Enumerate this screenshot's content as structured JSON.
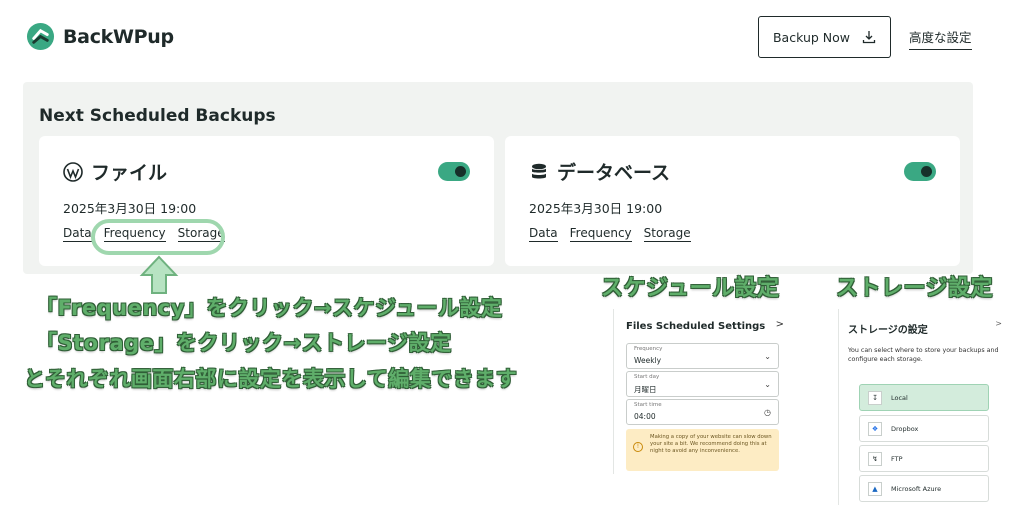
{
  "header": {
    "app_name": "BackWPup",
    "backup_now_label": "Backup Now",
    "advanced_settings_label": "高度な設定"
  },
  "scheduled": {
    "title": "Next Scheduled Backups",
    "cards": [
      {
        "title": "ファイル",
        "date": "2025年3月30日 19:00",
        "links": [
          "Data",
          "Frequency",
          "Storage"
        ],
        "enabled": true
      },
      {
        "title": "データベース",
        "date": "2025年3月30日 19:00",
        "links": [
          "Data",
          "Frequency",
          "Storage"
        ],
        "enabled": true
      }
    ]
  },
  "annotations": {
    "line1": "「Frequency」をクリック→スケジュール設定",
    "line2": "「Storage」をクリック→ストレージ設定",
    "line3": "とそれぞれ画面右部に設定を表示して編集できます",
    "schedule_heading": "スケジュール設定",
    "storage_heading": "ストレージ設定"
  },
  "schedule_panel": {
    "title": "Files Scheduled Settings",
    "close": ">",
    "fields": [
      {
        "label": "Frequency",
        "value": "Weekly",
        "icon": "chevron-down-icon"
      },
      {
        "label": "Start day",
        "value": "月曜日",
        "icon": "chevron-down-icon"
      },
      {
        "label": "Start time",
        "value": "04:00",
        "icon": "clock-icon"
      }
    ],
    "warning": "Making a copy of your website can slow down your site a bit. We recommend doing this at night to avoid any inconvenience."
  },
  "storage_panel": {
    "title": "ストレージの設定",
    "close": ">",
    "description": "You can select where to store your backups and configure each storage.",
    "items": [
      "Local",
      "Dropbox",
      "FTP",
      "Microsoft Azure"
    ]
  },
  "colors": {
    "accent": "#3aa883",
    "highlight": "#9fd7ae",
    "annotation": "#5fae6a",
    "warning_bg": "#fdecc4"
  }
}
